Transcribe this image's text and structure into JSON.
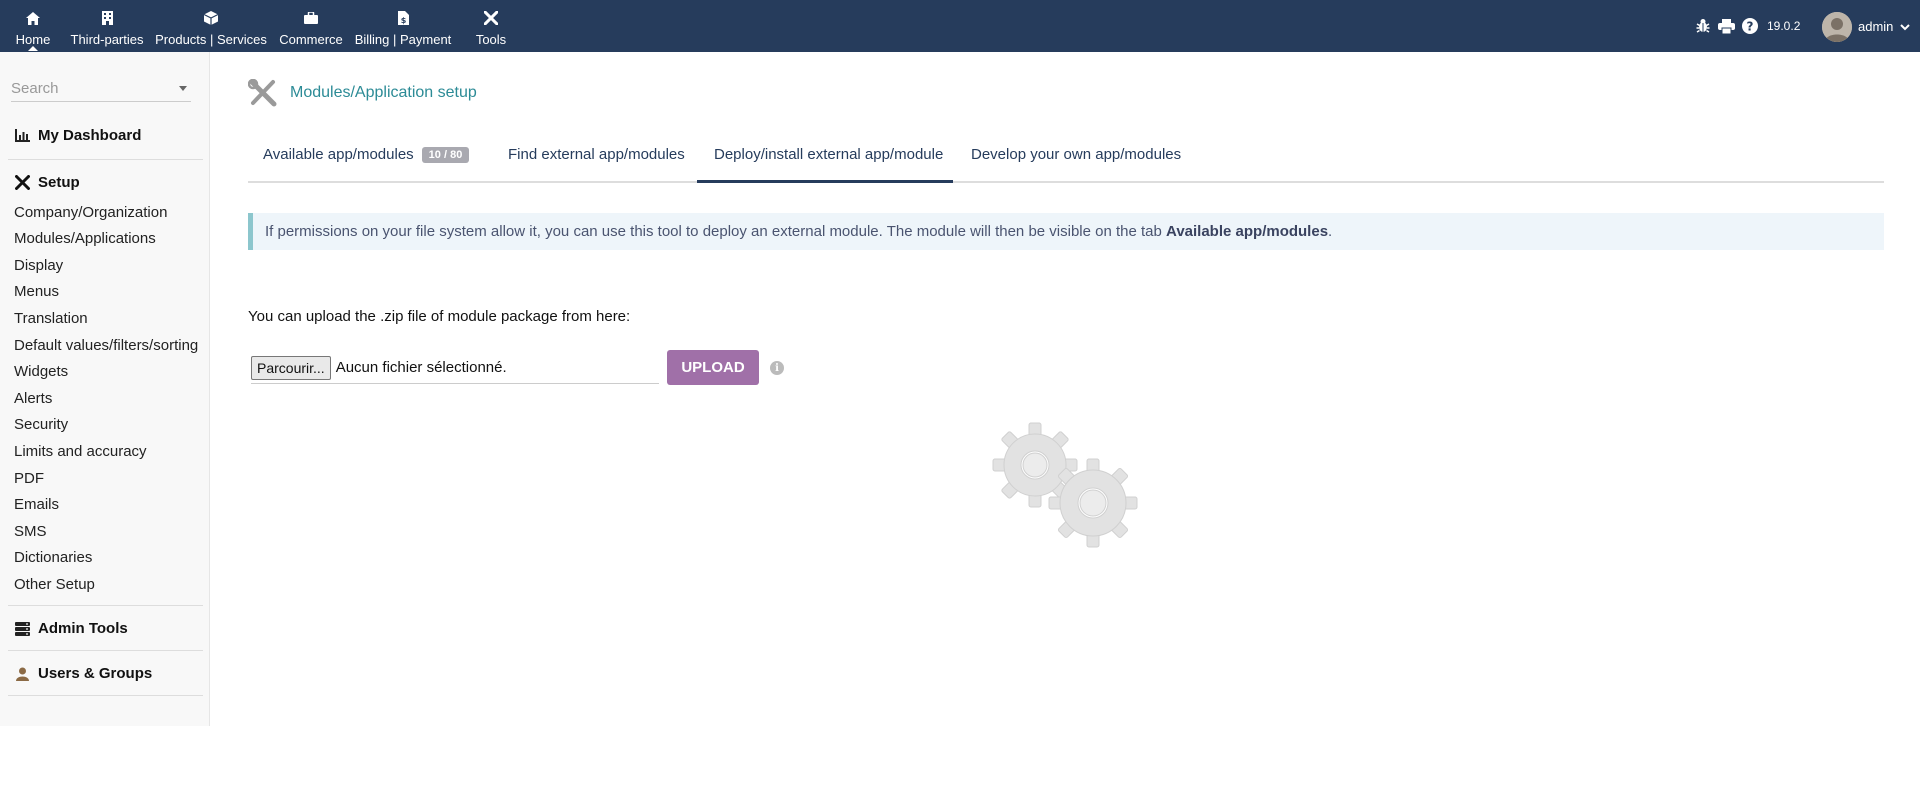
{
  "topbar": {
    "menus": [
      {
        "label": "Home",
        "icon": "home-icon"
      },
      {
        "label": "Third-parties",
        "icon": "building-icon"
      },
      {
        "label": "Products | Services",
        "icon": "cube-icon"
      },
      {
        "label": "Commerce",
        "icon": "briefcase-icon"
      },
      {
        "label": "Billing | Payment",
        "icon": "file-dollar-icon"
      },
      {
        "label": "Tools",
        "icon": "tools-icon"
      }
    ],
    "version": "19.0.2",
    "user": "admin",
    "right_icons": [
      "bug-icon",
      "print-icon",
      "help-icon"
    ]
  },
  "sidebar": {
    "search_placeholder": "Search",
    "dashboard": "My Dashboard",
    "setup": "Setup",
    "setup_items": [
      "Company/Organization",
      "Modules/Applications",
      "Display",
      "Menus",
      "Translation",
      "Default values/filters/sorting",
      "Widgets",
      "Alerts",
      "Security",
      "Limits and accuracy",
      "PDF",
      "Emails",
      "SMS",
      "Dictionaries",
      "Other Setup"
    ],
    "admin_tools": "Admin Tools",
    "users_groups": "Users & Groups"
  },
  "main": {
    "title": "Modules/Application setup",
    "tabs": [
      {
        "label": "Available app/modules",
        "badge": "10 / 80"
      },
      {
        "label": "Find external app/modules"
      },
      {
        "label": "Deploy/install external app/module",
        "active": true
      },
      {
        "label": "Develop your own app/modules"
      }
    ],
    "info_text": "If permissions on your file system allow it, you can use this tool to deploy an external module. The module will then be visible on the tab ",
    "info_bold": "Available app/modules",
    "info_end": ".",
    "upload_text": "You can upload the .zip file of module package from here:",
    "browse_label": "Parcourir...",
    "file_status": "Aucun fichier sélectionné.",
    "upload_label": "UPLOAD",
    "info_icon": "i"
  },
  "colors": {
    "topbar": "#263c5c",
    "title": "#2c8b96",
    "upload_button": "#a070a8",
    "info_border": "#8cc6cd",
    "info_bg": "#eef5fa"
  }
}
